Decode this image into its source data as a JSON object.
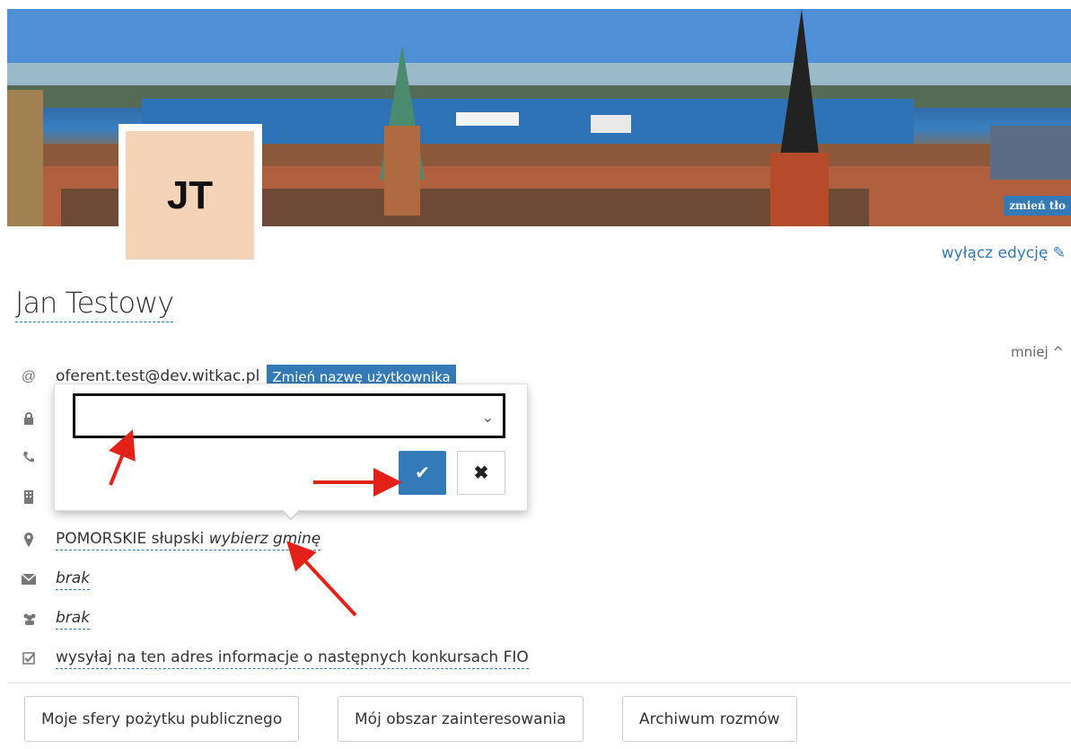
{
  "banner": {
    "change_bg_label": "zmień tło"
  },
  "avatar": {
    "initials": "JT"
  },
  "edit_toggle_label": "wyłącz edycję",
  "profile": {
    "name": "Jan Testowy",
    "less_label": "mniej ^"
  },
  "info": {
    "email": "oferent.test@dev.witkac.pl",
    "rename_button": "Zmień nazwę użytkownika",
    "location_region": "POMORSKIE",
    "location_county": "słupski",
    "location_commune": "wybierz gminę",
    "mail_value": "brak",
    "group_value": "brak",
    "newsletter": "wysyłaj na ten adres informacje o następnych konkursach FIO"
  },
  "popover": {
    "select_value": "",
    "ok_icon": "check-icon",
    "cancel_icon": "close-icon"
  },
  "tabs": [
    "Moje sfery pożytku publicznego",
    "Mój obszar zainteresowania",
    "Archiwum rozmów"
  ]
}
